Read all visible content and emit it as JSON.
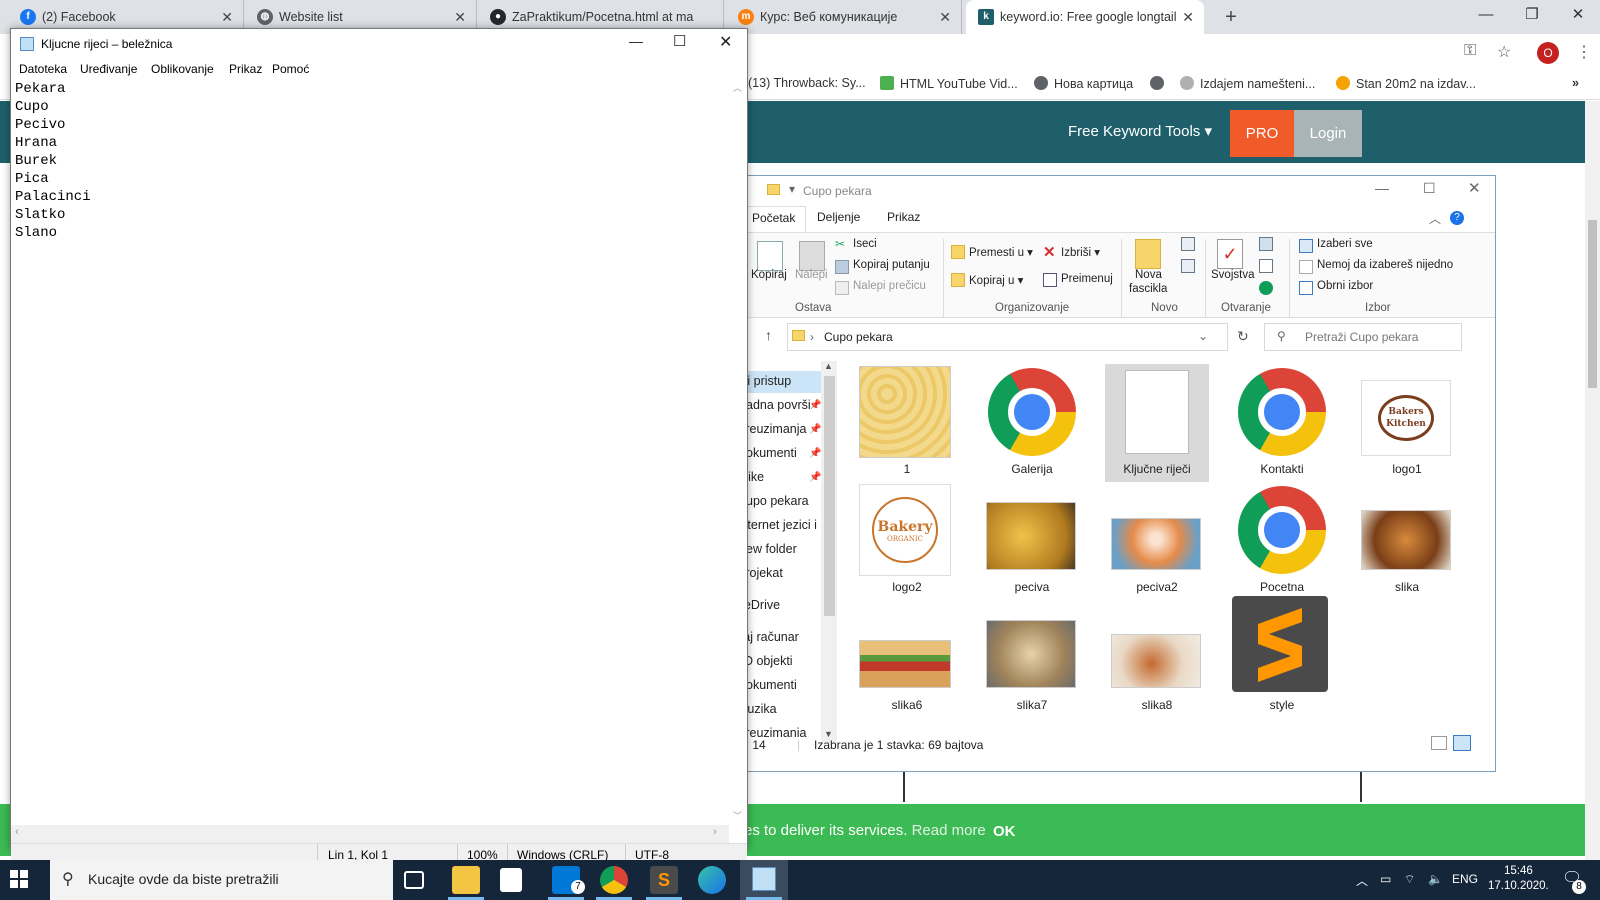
{
  "browser": {
    "tabs": [
      {
        "title": "(2) Facebook",
        "icon": "facebook-icon",
        "color": "#1877f2"
      },
      {
        "title": "Website list",
        "icon": "globe-icon",
        "color": "#5f6368"
      },
      {
        "title": "ZaPraktikum/Pocetna.html at ma",
        "icon": "github-icon",
        "color": "#24292e"
      },
      {
        "title": "Курс: Веб комуникације",
        "icon": "moodle-icon",
        "color": "#f98012"
      },
      {
        "title": "keyword.io: Free google longtail",
        "icon": "keyword-io-icon",
        "color": "#1e5f6b"
      }
    ],
    "profile_initial": "O",
    "bookmarks": [
      {
        "label": "(13) Throwback: Sy...",
        "icon": "youtube-icon",
        "color": "#ff0000"
      },
      {
        "label": "HTML YouTube Vid...",
        "icon": "w3schools-icon",
        "color": "#4caf50"
      },
      {
        "label": "Нова картица",
        "icon": "globe-icon",
        "color": "#5f6368"
      },
      {
        "label": "",
        "icon": "globe-icon",
        "color": "#5f6368"
      },
      {
        "label": "Izdajem namešteni...",
        "icon": "halo-oglasi-icon",
        "color": "#b0b0b0"
      },
      {
        "label": "Stan 20m2 na izdav...",
        "icon": "person-icon",
        "color": "#f4a300"
      }
    ]
  },
  "website": {
    "nav_tools": "Free Keyword Tools",
    "pro": "PRO",
    "login": "Login",
    "header_color": "#1e5f6b",
    "cookie_text": "es to deliver its services.",
    "cookie_read_more": "Read more",
    "cookie_ok": "OK"
  },
  "explorer": {
    "title": "Cupo pekara",
    "tabs": [
      "Početak",
      "Deljenje",
      "Prikaz"
    ],
    "ribbon": {
      "clipboard_partial": [
        "a",
        "up"
      ],
      "copy": "Kopiraj",
      "paste": "Nalepi",
      "cut": "Iseci",
      "copy_path": "Kopiraj putanju",
      "paste_shortcut": "Nalepi prečicu",
      "group_clipboard": "Ostava",
      "move_to": "Premesti u",
      "copy_to": "Kopiraj u",
      "delete": "Izbriši",
      "rename": "Preimenuj",
      "group_organize": "Organizovanje",
      "new_folder": [
        "Nova",
        "fascikla"
      ],
      "group_new": "Novo",
      "properties": "Svojstva",
      "group_open": "Otvaranje",
      "select_all": "Izaberi sve",
      "select_none": "Nemoj da izabereš nijedno",
      "invert_selection": "Obrni izbor",
      "group_select": "Izbor"
    },
    "address": "Cupo pekara",
    "search_placeholder": "Pretraži Cupo pekara",
    "nav": [
      {
        "label": "rzi pristup",
        "pinned": false
      },
      {
        "label": "Radna površi",
        "pinned": true
      },
      {
        "label": "Preuzimanja",
        "pinned": true
      },
      {
        "label": "Dokumenti",
        "pinned": true
      },
      {
        "label": "Slike",
        "pinned": true
      },
      {
        "label": "Cupo pekara",
        "pinned": false
      },
      {
        "label": "Internet jezici i a",
        "pinned": false
      },
      {
        "label": "New folder",
        "pinned": false
      },
      {
        "label": "Projekat",
        "pinned": false
      },
      {
        "label": "neDrive",
        "pinned": false
      },
      {
        "label": "vaj računar",
        "pinned": false
      },
      {
        "label": "3D objekti",
        "pinned": false
      },
      {
        "label": "Dokumenti",
        "pinned": false
      },
      {
        "label": "Muzika",
        "pinned": false
      },
      {
        "label": "Preuzimania",
        "pinned": false
      }
    ],
    "files": [
      {
        "name": "1",
        "kind": "pattern-image"
      },
      {
        "name": "Galerija",
        "kind": "chrome-html"
      },
      {
        "name": "Ključne riječi",
        "kind": "text-file",
        "selected": true
      },
      {
        "name": "Kontakti",
        "kind": "chrome-html"
      },
      {
        "name": "logo1",
        "kind": "logo-image"
      },
      {
        "name": "logo2",
        "kind": "logo-image"
      },
      {
        "name": "peciva",
        "kind": "food-image"
      },
      {
        "name": "peciva2",
        "kind": "food-image"
      },
      {
        "name": "Pocetna",
        "kind": "chrome-html"
      },
      {
        "name": "slika",
        "kind": "food-image"
      },
      {
        "name": "slika6",
        "kind": "food-image"
      },
      {
        "name": "slika7",
        "kind": "food-image"
      },
      {
        "name": "slika8",
        "kind": "food-image"
      },
      {
        "name": "style",
        "kind": "sublime-file"
      }
    ],
    "logo1_text": "Bakers Kitchen",
    "logo2_text": "Bakery",
    "logo2_sub": "ORGANIC",
    "status_count": "ki: 14",
    "status_selection": "Izabrana je 1 stavka: 69 bajtova"
  },
  "notepad": {
    "title": "Kljucne rijeci – beležnica",
    "menu": [
      "Datoteka",
      "Uređivanje",
      "Oblikovanje",
      "Prikaz",
      "Pomoć"
    ],
    "lines": [
      "Pekara",
      "Cupo",
      "Pecivo",
      "Hrana",
      "Burek",
      "Pica",
      "Palacinci",
      "Slatko",
      "Slano"
    ],
    "status": {
      "position": "Lin 1, Kol 1",
      "zoom": "100%",
      "line_endings": "Windows (CRLF)",
      "encoding": "UTF-8"
    }
  },
  "taskbar": {
    "search_placeholder": "Kucajte ovde da biste pretražili",
    "mail_badge": "7",
    "language": "ENG",
    "time": "15:46",
    "date": "17.10.2020.",
    "notification_count": "8"
  }
}
